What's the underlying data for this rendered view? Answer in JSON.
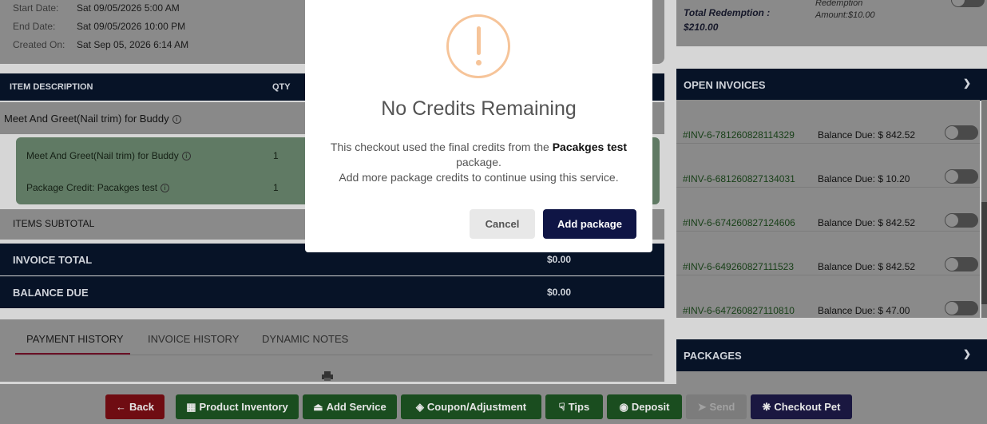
{
  "meta": {
    "start_label": "Start Date:",
    "start_value": "Sat 09/05/2026 5:00 AM",
    "end_label": "End Date:",
    "end_value": "Sat 09/05/2026 10:00 PM",
    "created_label": "Created On:",
    "created_value": "Sat Sep 05, 2026 6:14 AM"
  },
  "items_table": {
    "col_description": "ITEM DESCRIPTION",
    "col_qty": "QTY",
    "parent_item": "Meet And Greet(Nail trim) for Buddy",
    "sub_items": [
      {
        "label": "Meet And Greet(Nail trim) for Buddy",
        "qty": "1"
      },
      {
        "label": "Package Credit: Pacakges test",
        "qty": "1"
      }
    ],
    "info_glyph": "i"
  },
  "totals": {
    "subtotal_label": "ITEMS SUBTOTAL",
    "invoice_total_label": "INVOICE TOTAL",
    "invoice_total_value": "$0.00",
    "balance_due_label": "BALANCE DUE",
    "balance_due_value": "$0.00"
  },
  "history_tabs": [
    {
      "label": "PAYMENT HISTORY",
      "active": true
    },
    {
      "label": "INVOICE HISTORY",
      "active": false
    },
    {
      "label": "DYNAMIC NOTES",
      "active": false
    }
  ],
  "redemption": {
    "total_line1": "Total Redemption :",
    "total_line2": "$210.00",
    "amount_line1": "Redemption",
    "amount_line2": "Amount:$10.00"
  },
  "open_invoices": {
    "title": "OPEN INVOICES",
    "rows": [
      {
        "number": "#INV-6-781260828114329",
        "balance": "Balance Due: $ 842.52"
      },
      {
        "number": "#INV-6-681260827134031",
        "balance": "Balance Due: $ 10.20"
      },
      {
        "number": "#INV-6-674260827124606",
        "balance": "Balance Due: $ 842.52"
      },
      {
        "number": "#INV-6-649260827111523",
        "balance": "Balance Due: $ 842.52"
      },
      {
        "number": "#INV-6-647260827110810",
        "balance": "Balance Due: $ 47.00"
      }
    ]
  },
  "packages": {
    "title": "PACKAGES"
  },
  "toolbar": {
    "back": "Back",
    "product_inventory": "Product Inventory",
    "add_service": "Add Service",
    "coupon": "Coupon/Adjustment",
    "tips": "Tips",
    "deposit": "Deposit",
    "send": "Send",
    "checkout": "Checkout Pet"
  },
  "modal": {
    "title": "No Credits Remaining",
    "text_before": "This checkout used the final credits from the",
    "package_name": "Pacakges test",
    "text_after": "package.",
    "text_line2": "Add more package credits to continue using this service.",
    "cancel": "Cancel",
    "add_package": "Add package"
  },
  "colors": {
    "navy": "#071327",
    "accent_orange": "#f6c499",
    "add_package_button": "#0f1545"
  }
}
